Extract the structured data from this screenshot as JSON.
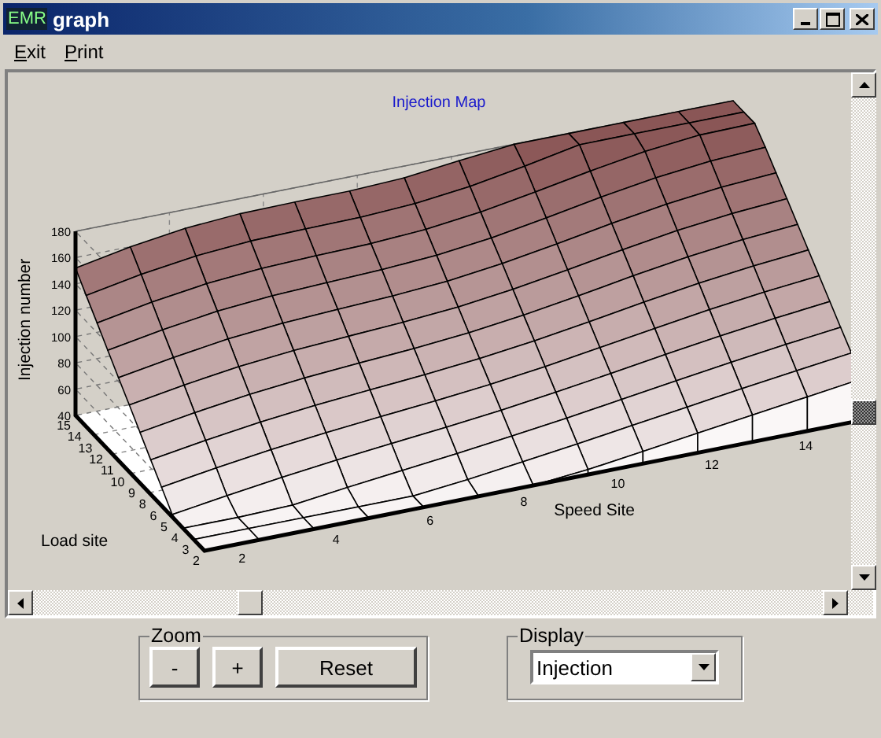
{
  "window": {
    "icon_text": "EMR",
    "title": "graph"
  },
  "menu": [
    {
      "label": "Exit"
    },
    {
      "label": "Print"
    }
  ],
  "chart": {
    "title": "Injection Map",
    "z_label": "Injection number",
    "z_ticks": [
      "180",
      "160",
      "140",
      "120",
      "100",
      "80",
      "60",
      "40"
    ],
    "load_label": "Load site",
    "load_ticks": [
      "15",
      "14",
      "13",
      "12",
      "11",
      "10",
      "9",
      "8",
      "6",
      "5",
      "4",
      "3",
      "2"
    ],
    "speed_label": "Speed Site",
    "speed_ticks": [
      "2",
      "4",
      "6",
      "8",
      "10",
      "12",
      "14"
    ]
  },
  "zoom": {
    "title": "Zoom",
    "buttons": [
      "-",
      "+",
      "Reset"
    ]
  },
  "display": {
    "title": "Display",
    "value": "Injection"
  }
}
